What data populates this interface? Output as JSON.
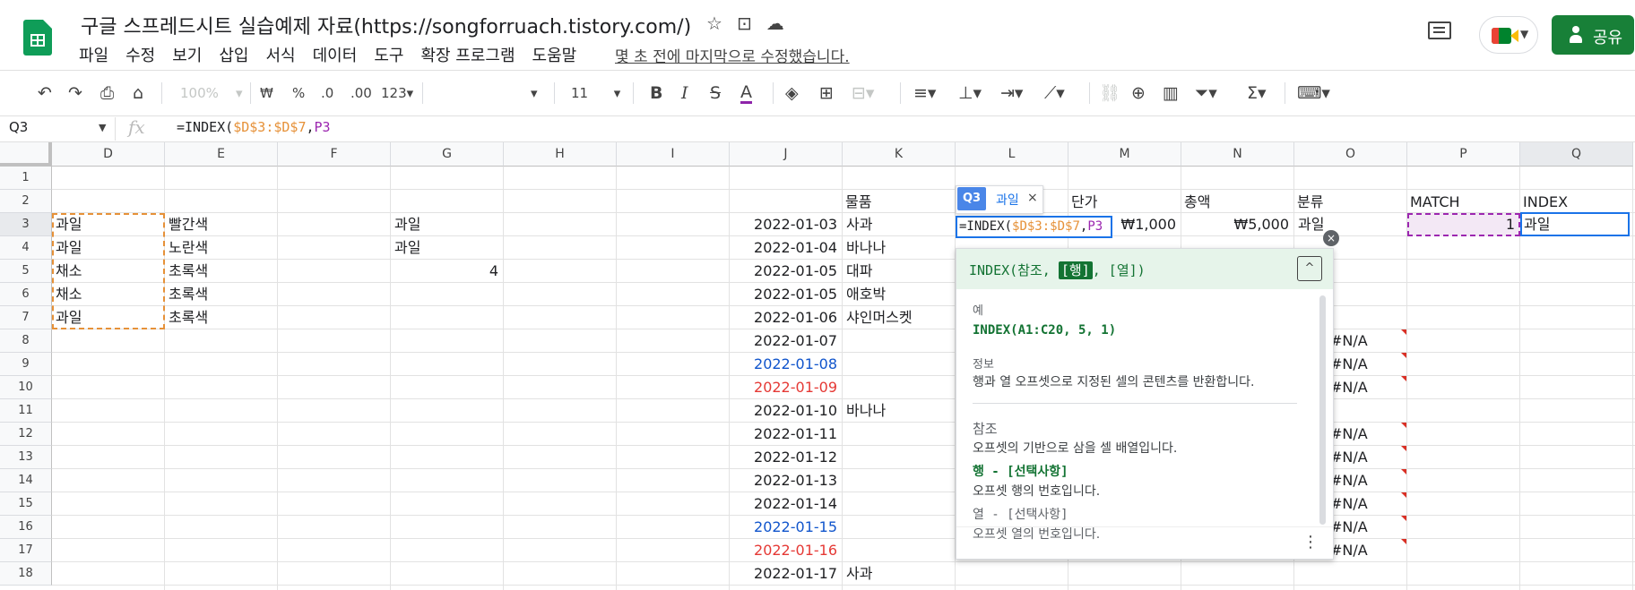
{
  "header": {
    "doc_title": "구글 스프레드시트 실습예제 자료(https://songforruach.tistory.com/)",
    "menu": [
      "파일",
      "수정",
      "보기",
      "삽입",
      "서식",
      "데이터",
      "도구",
      "확장 프로그램",
      "도움말"
    ],
    "last_edit": "몇 초 전에 마지막으로 수정했습니다.",
    "share_label": "공유",
    "icons": [
      "star-icon",
      "move-to-folder-icon",
      "cloud-status-icon",
      "comment-history-icon",
      "meet-icon",
      "share-person-icon"
    ]
  },
  "toolbar": {
    "zoom": "100%",
    "currency": "₩",
    "percent": "%",
    "dec_decrease": ".0",
    "dec_increase": ".00",
    "more_formats": "123",
    "font_size": "11",
    "icons": [
      "undo-icon",
      "redo-icon",
      "print-icon",
      "paint-format-icon",
      "bold-icon",
      "italic-icon",
      "strikethrough-icon",
      "text-color-icon",
      "fill-color-icon",
      "borders-icon",
      "merge-cells-icon",
      "horizontal-align-icon",
      "vertical-align-icon",
      "text-wrap-icon",
      "text-rotation-icon",
      "link-icon",
      "comment-icon",
      "chart-icon",
      "filter-icon",
      "functions-icon",
      "input-tools-icon"
    ]
  },
  "formula_bar": {
    "name_box": "Q3",
    "fx": "fx",
    "formula_prefix": "=INDEX(",
    "formula_range": "$D$3:$D$7",
    "formula_comma": ",",
    "formula_ref": "P3"
  },
  "columns": [
    "D",
    "E",
    "F",
    "G",
    "H",
    "I",
    "J",
    "K",
    "L",
    "M",
    "N",
    "O",
    "P",
    "Q"
  ],
  "rows": [
    "1",
    "2",
    "3",
    "4",
    "5",
    "6",
    "7",
    "8",
    "9",
    "10",
    "11",
    "12",
    "13",
    "14",
    "15",
    "16",
    "17",
    "18"
  ],
  "header_row": {
    "K": "물품",
    "M": "단가",
    "N": "총액",
    "O": "분류",
    "P": "MATCH",
    "Q": "INDEX"
  },
  "cells": {
    "D3": "과일",
    "D4": "과일",
    "D5": "채소",
    "D6": "채소",
    "D7": "과일",
    "E3": "빨간색",
    "E4": "노란색",
    "E5": "초록색",
    "E6": "초록색",
    "E7": "초록색",
    "G3": "과일",
    "G4": "과일",
    "G5": "4",
    "J3": "2022-01-03",
    "J4": "2022-01-04",
    "J5": "2022-01-05",
    "J6": "2022-01-05",
    "J7": "2022-01-06",
    "J8": "2022-01-07",
    "J9": "2022-01-08",
    "J10": "2022-01-09",
    "J11": "2022-01-10",
    "J12": "2022-01-11",
    "J13": "2022-01-12",
    "J14": "2022-01-13",
    "J15": "2022-01-14",
    "J16": "2022-01-15",
    "J17": "2022-01-16",
    "J18": "2022-01-17",
    "K3": "사과",
    "K4": "바나나",
    "K5": "대파",
    "K6": "애호박",
    "K7": "샤인머스켓",
    "K11": "바나나",
    "K18": "사과",
    "M3": "₩1,000",
    "N3": "₩5,000",
    "O3": "과일",
    "O8": "#N/A",
    "O9": "#N/A",
    "O10": "#N/A",
    "O12": "#N/A",
    "O13": "#N/A",
    "O14": "#N/A",
    "O15": "#N/A",
    "O16": "#N/A",
    "O17": "#N/A",
    "P3": "1",
    "Q3": "과일"
  },
  "edit_cell": {
    "prefix": "=INDEX(",
    "range": "$D$3:$D$7",
    "comma": ",",
    "ref": "P3"
  },
  "ref_chip": {
    "ref": "Q3",
    "value": "과일",
    "close": "×"
  },
  "help": {
    "sig_prefix": "INDEX(참조, ",
    "sig_highlight": "[행]",
    "sig_suffix": ", [열])",
    "example_label": "예",
    "example": "INDEX(A1:C20, 5, 1)",
    "about_label": "정보",
    "about": "행과 열 오프셋으로 지정된 셀의 콘텐츠를 반환합니다.",
    "arg1_name": "참조",
    "arg1_desc": "오프셋의 기반으로 삼을 셀 배열입니다.",
    "arg2_name": "행 - [선택사항]",
    "arg2_desc": "오프셋 행의 번호입니다.",
    "arg3_name": "열 - [선택사항]",
    "arg3_desc": "오프셋 열의 번호입니다.",
    "collapse": "^",
    "close": "×",
    "more": "⋮"
  },
  "colors": {
    "accent": "#1a73e8",
    "brand_green": "#188038",
    "formula_range": "#e69138",
    "formula_ref": "#9c27b0",
    "blue_date": "#1155cc",
    "red_date": "#e53935",
    "error_mark": "#d93025"
  }
}
